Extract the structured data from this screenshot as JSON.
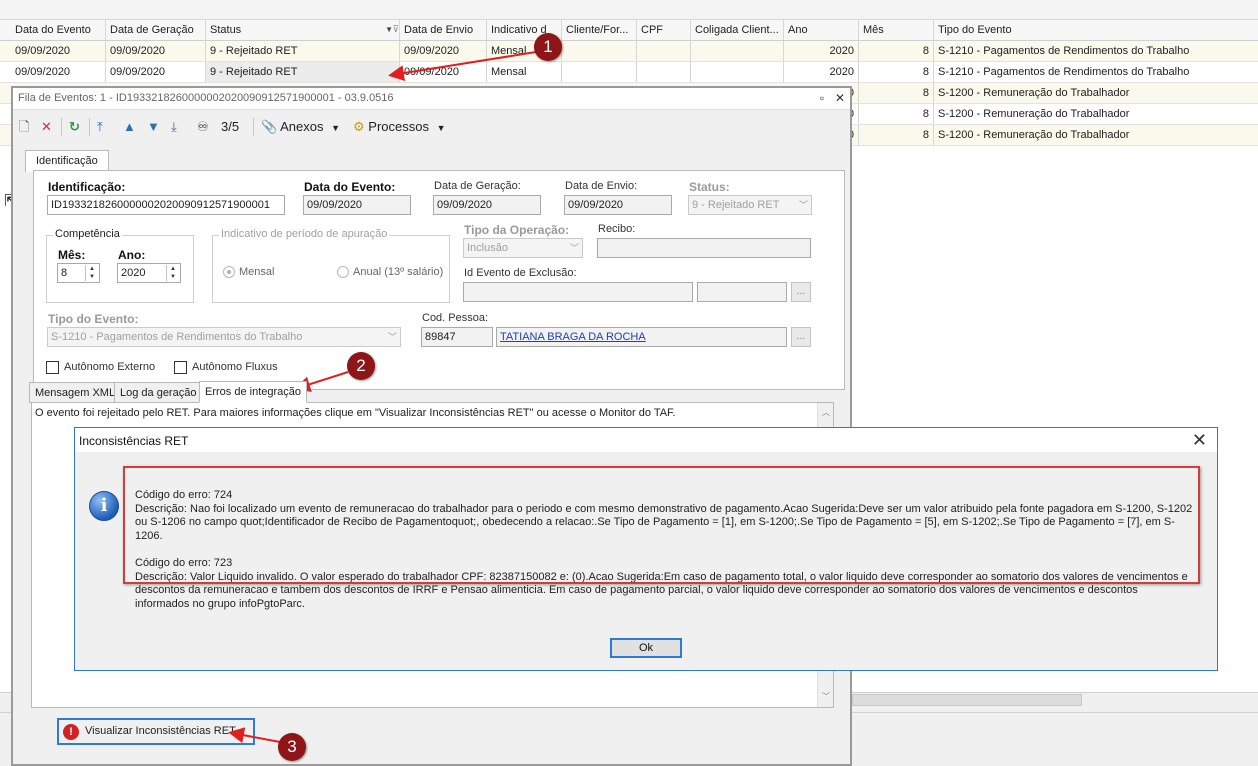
{
  "grid": {
    "columns": [
      "Data do Evento",
      "Data de Geração",
      "Status",
      "Data de Envio",
      "Indicativo d",
      "Cliente/For...",
      "CPF",
      "Coligada Client...",
      "Ano",
      "Mês",
      "Tipo do Evento"
    ],
    "rows": [
      {
        "data_evento": "09/09/2020",
        "data_geracao": "09/09/2020",
        "status": "9 - Rejeitado RET",
        "data_envio": "09/09/2020",
        "indicativo": "Mensal",
        "ano": "2020",
        "mes": "8",
        "tipo": "S-1210 - Pagamentos de Rendimentos do Trabalho"
      },
      {
        "data_evento": "09/09/2020",
        "data_geracao": "09/09/2020",
        "status": "9 - Rejeitado RET",
        "data_envio": "09/09/2020",
        "indicativo": "Mensal",
        "ano": "2020",
        "mes": "8",
        "tipo": "S-1210 - Pagamentos de Rendimentos do Trabalho"
      },
      {
        "ano": "0",
        "mes": "8",
        "tipo": "S-1200 - Remuneração do Trabalhador"
      },
      {
        "ano": "0",
        "mes": "8",
        "tipo": "S-1200 - Remuneração do Trabalhador"
      },
      {
        "ano": "0",
        "mes": "8",
        "tipo": "S-1200 - Remuneração do Trabalhador"
      }
    ]
  },
  "window": {
    "title": "Fila de Eventos: 1 - ID1933218260000002020090912571900001 - 03.9.0516",
    "toolbar": {
      "counter": "3/5",
      "anexos": "Anexos",
      "processos": "Processos"
    },
    "main_tab": "Identificação",
    "form": {
      "identificacao_label": "Identificação:",
      "identificacao_value": "ID1933218260000002020090912571900001",
      "data_evento_label": "Data do Evento:",
      "data_evento_value": "09/09/2020",
      "data_geracao_label": "Data de Geração:",
      "data_geracao_value": "09/09/2020",
      "data_envio_label": "Data de Envio:",
      "data_envio_value": "09/09/2020",
      "status_label": "Status:",
      "status_value": "9 - Rejeitado RET",
      "competencia_label": "Competência",
      "mes_label": "Mês:",
      "mes_value": "8",
      "ano_label": "Ano:",
      "ano_value": "2020",
      "indicativo_label": "Indicativo de período de apuração",
      "mensal_label": "Mensal",
      "anual_label": "Anual (13º salário)",
      "tipo_operacao_label": "Tipo da Operação:",
      "tipo_operacao_value": "Inclusão",
      "recibo_label": "Recibo:",
      "id_exclusao_label": "Id Evento de Exclusão:",
      "tipo_evento_label": "Tipo do Evento:",
      "tipo_evento_value": "S-1210 - Pagamentos de Rendimentos do Trabalho",
      "cod_pessoa_label": "Cod. Pessoa:",
      "cod_pessoa_value": "89847",
      "pessoa_nome": "TATIANA BRAGA DA ROCHA",
      "autonomo_externo": "Autônomo Externo",
      "autonomo_fluxus": "Autônomo Fluxus",
      "ellipsis": "..."
    },
    "sub_tabs": [
      "Mensagem XML",
      "Log da geração",
      "Erros de integração"
    ],
    "error_text": "O evento foi rejeitado pelo RET. Para maiores informações clique em \"Visualizar Inconsistências RET\" ou acesse o Monitor do TAF.",
    "visualizar_button": "Visualizar Inconsistências RET"
  },
  "dialog": {
    "title": "Inconsistências RET",
    "errors": [
      {
        "codigo": "Código do erro: 724",
        "descricao": "Descrição: Nao foi localizado um evento de remuneracao do trabalhador para o periodo e com mesmo demonstrativo de pagamento.Acao Sugerida:Deve ser um valor atribuido pela fonte pagadora em S-1200, S-1202 ou S-1206 no campo quot;Identificador de Recibo de Pagamentoquot;, obedecendo a relacao:.Se Tipo de Pagamento = [1], em S-1200;.Se Tipo de Pagamento = [5], em S-1202;.Se Tipo de Pagamento = [7], em S-1206."
      },
      {
        "codigo": "Código do erro: 723",
        "descricao": "Descrição: Valor Liquido invalido. O valor esperado do trabalhador CPF: 82387150082 e: (0).Acao Sugerida:Em caso de pagamento total, o valor liquido deve corresponder ao somatorio dos valores de vencimentos e descontos da remuneracao e tambem dos descontos de IRRF e Pensao alimenticia. Em caso de pagamento parcial, o valor liquido deve corresponder ao somatorio dos valores de vencimentos e descontos informados no grupo infoPgtoParc."
      }
    ],
    "ok_label": "Ok"
  },
  "annotations": {
    "badge1": "1",
    "badge2": "2",
    "badge3": "3"
  },
  "colors": {
    "badge": "#8e1518",
    "highlight": "#d43b3b",
    "focus_border": "#2c7bd8",
    "link": "#1a3fc0"
  }
}
